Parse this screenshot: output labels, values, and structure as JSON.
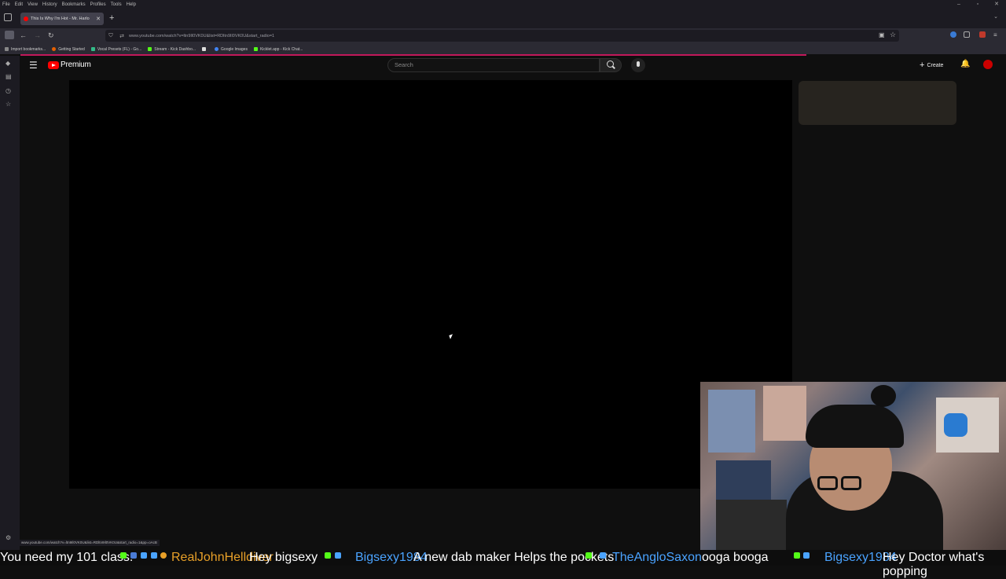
{
  "menu_bar": [
    "File",
    "Edit",
    "View",
    "History",
    "Bookmarks",
    "Profiles",
    "Tools",
    "Help"
  ],
  "window_controls": {
    "minimize": "–",
    "restore": "▫",
    "close": "✕"
  },
  "tab": {
    "title": "This Is Why I'm Hot - Mr. Harlo",
    "close": "✕"
  },
  "new_tab": "+",
  "tab_overflow": "⌄",
  "nav": {
    "back": "←",
    "forward": "→",
    "reload": "↻"
  },
  "url": "www.youtube.com/watch?v=ltn9Il0VK0U&list=RDltn9Il0VK0U&start_radio=1",
  "bookmarks": [
    {
      "label": "Import bookmarks...",
      "color": "#888"
    },
    {
      "label": "Getting Started",
      "color": "#e66000"
    },
    {
      "label": "Vocal Presets (FL) - Go...",
      "color": "#3b8"
    },
    {
      "label": "Stream - Kick Dashbo...",
      "color": "#53fc18"
    },
    {
      "label": "",
      "color": "#ddd"
    },
    {
      "label": "Google Images",
      "color": "#4285f4"
    },
    {
      "label": "Kicklet.app - Kick Chat...",
      "color": "#53fc18"
    }
  ],
  "youtube": {
    "menu_icon": "☰",
    "logo_text": "Premium",
    "search_placeholder": "Search",
    "create_plus": "+",
    "create_label": "Create",
    "bell": "🔔"
  },
  "status_url": "www.youtube.com/watch?v=ltn9Il0VK0U&list=RDltn9Il0VK0U&start_radio=1&pp=oAcB",
  "sidebar_icons": [
    "◆",
    "▤",
    "◷",
    "☆"
  ],
  "gear": "⚙",
  "ticker": {
    "segments": [
      {
        "text": "You need my 101 class.",
        "color": "#ffffff"
      },
      {
        "text": "RealJohnHelldiver",
        "color": "#e8a028"
      },
      {
        "text": "Hey bigsexy",
        "color": "#ffffff"
      },
      {
        "text": "Bigsexy1984",
        "color": "#4aa3ff"
      },
      {
        "text": "A new dab maker Helps the pockets",
        "color": "#ffffff"
      },
      {
        "text": "TheAngloSaxon",
        "color": "#4aa3ff"
      },
      {
        "text": "ooga booga",
        "color": "#ffffff"
      },
      {
        "text": "Bigsexy1984",
        "color": "#4aa3ff"
      },
      {
        "text": "Hey Doctor what's popping",
        "color": "#ffffff"
      }
    ]
  }
}
